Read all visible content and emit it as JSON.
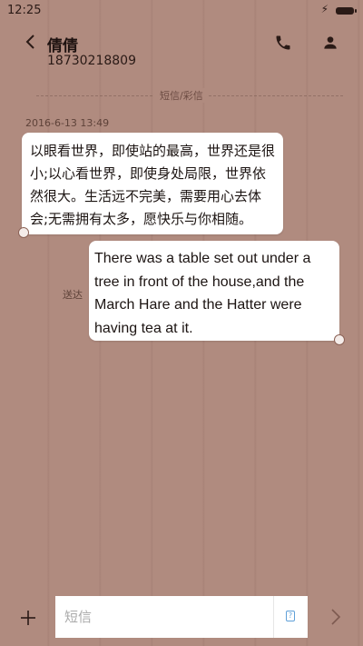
{
  "status_bar": {
    "time": "12:25"
  },
  "header": {
    "contact_name": "倩倩",
    "contact_number": "18730218809"
  },
  "divider": {
    "label": "短信/彩信"
  },
  "conversation": {
    "timestamp": "2016-6-13 13:49",
    "messages": [
      {
        "direction": "incoming",
        "text": "以眼看世界，即使站的最高，世界还是很小;以心看世界，即使身处局限，世界依然很大。生活远不完美，需要用心去体会;无需拥有太多，愿快乐与你相随。"
      },
      {
        "direction": "outgoing",
        "text": "There was a table set out under a tree in front of the house,and the March Hare and the Hatter were having tea at it."
      }
    ],
    "sent_status": "送达"
  },
  "composer": {
    "placeholder": "短信",
    "value": ""
  },
  "colors": {
    "background": "#b08b7f",
    "bubble": "#ffffff",
    "accent": "#5fa0d8"
  },
  "icons": [
    "back-arrow-icon",
    "phone-icon",
    "person-icon",
    "bolt-icon",
    "battery-icon",
    "plus-icon",
    "attachment-icon",
    "send-icon"
  ]
}
